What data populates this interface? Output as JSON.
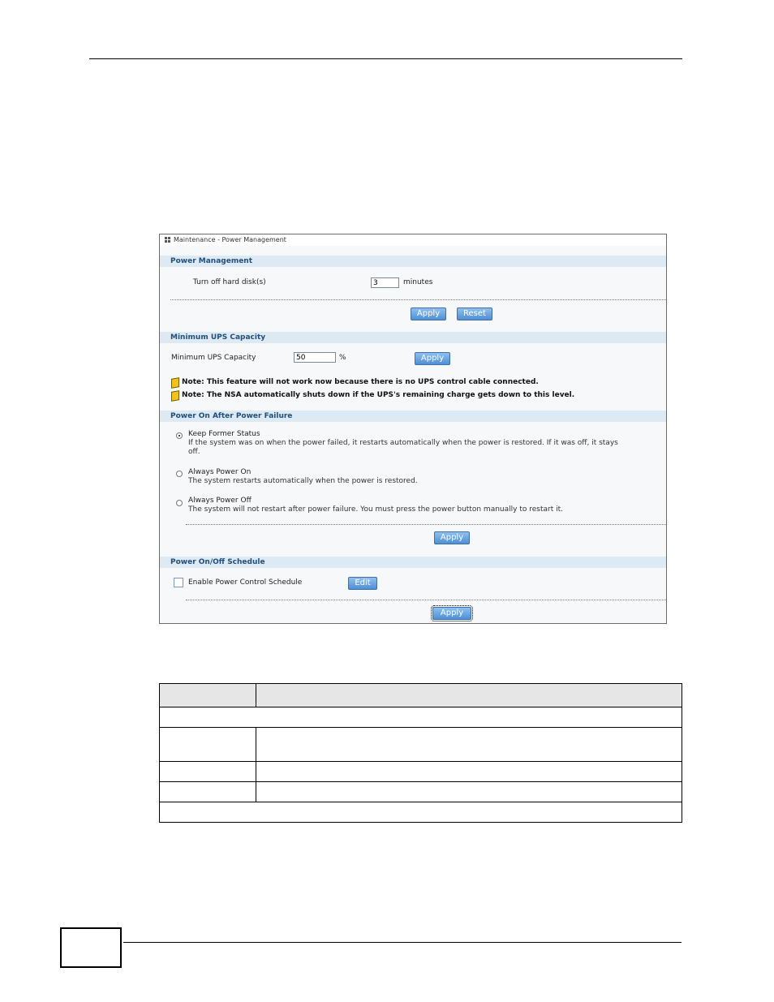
{
  "panel": {
    "breadcrumb": "Maintenance - Power Management",
    "power_management": {
      "title": "Power Management",
      "turn_off_label": "Turn off hard disk(s)",
      "turn_off_value": "3",
      "turn_off_unit": "minutes",
      "apply": "Apply",
      "reset": "Reset"
    },
    "ups": {
      "title": "Minimum UPS Capacity",
      "label": "Minimum UPS Capacity",
      "value": "50",
      "unit": "%",
      "apply": "Apply",
      "note1": "Note: This feature will not work now because there is no UPS control cable connected.",
      "note2": "Note: The NSA automatically shuts down if the UPS's remaining charge gets down to this level."
    },
    "power_on": {
      "title": "Power On After Power Failure",
      "options": [
        {
          "label": "Keep Former Status",
          "desc1": "If the system was on when the power failed, it restarts automatically when the power is restored. If it was off, it stays",
          "desc2": "off.",
          "selected": true
        },
        {
          "label": "Always Power On",
          "desc1": "The system restarts automatically when the power is restored.",
          "selected": false
        },
        {
          "label": "Always Power Off",
          "desc1": "The system will not restart after power failure. You must press the power button manually to restart it.",
          "selected": false
        }
      ],
      "apply": "Apply"
    },
    "schedule": {
      "title": "Power On/Off Schedule",
      "checkbox_label": "Enable Power Control Schedule",
      "edit": "Edit",
      "apply": "Apply"
    }
  }
}
